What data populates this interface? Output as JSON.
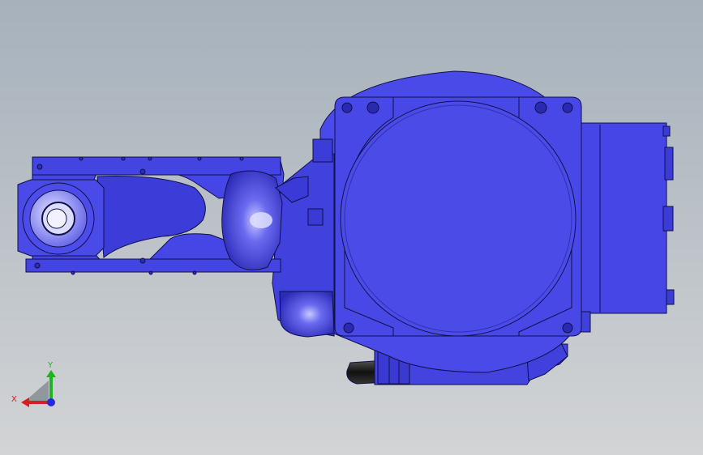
{
  "colors": {
    "background_top": "#a6b1bc",
    "background_bottom": "#d2d4d6",
    "model_fill": "#4646e6",
    "model_dark": "#2a2ab8",
    "model_light": "#8a8af5",
    "edge": "#10104a",
    "black_part": "#141414",
    "axis_x": "#d81e1e",
    "axis_y": "#18b818",
    "axis_z": "#2828d8"
  },
  "triad": {
    "x_label": "X",
    "y_label": "Y"
  },
  "model": {
    "icon": "robot-arm-model"
  }
}
